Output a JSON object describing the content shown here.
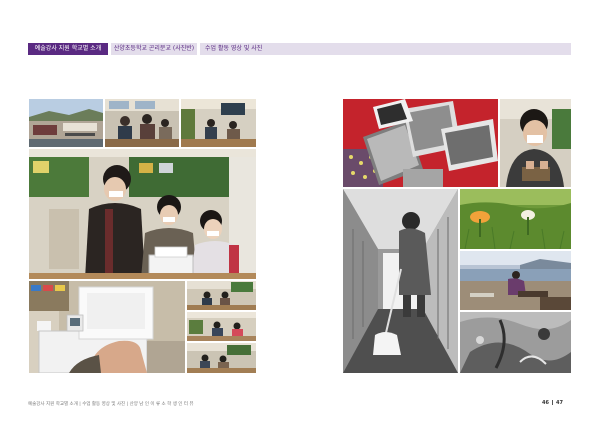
{
  "header": {
    "tag": "예술강사 지원 학교별 소개",
    "school": "산양초등학교 곤리분교 (사진반)",
    "description": "수업 활동 영상 및 사진"
  },
  "footer": {
    "note": "예술강사 지원 학교별 소개 | 수업 활동 영상 및 사진 | 산양 남 인 이 류 소 학 생 인 터 뷰",
    "page_left": "46",
    "page_right": "47"
  }
}
